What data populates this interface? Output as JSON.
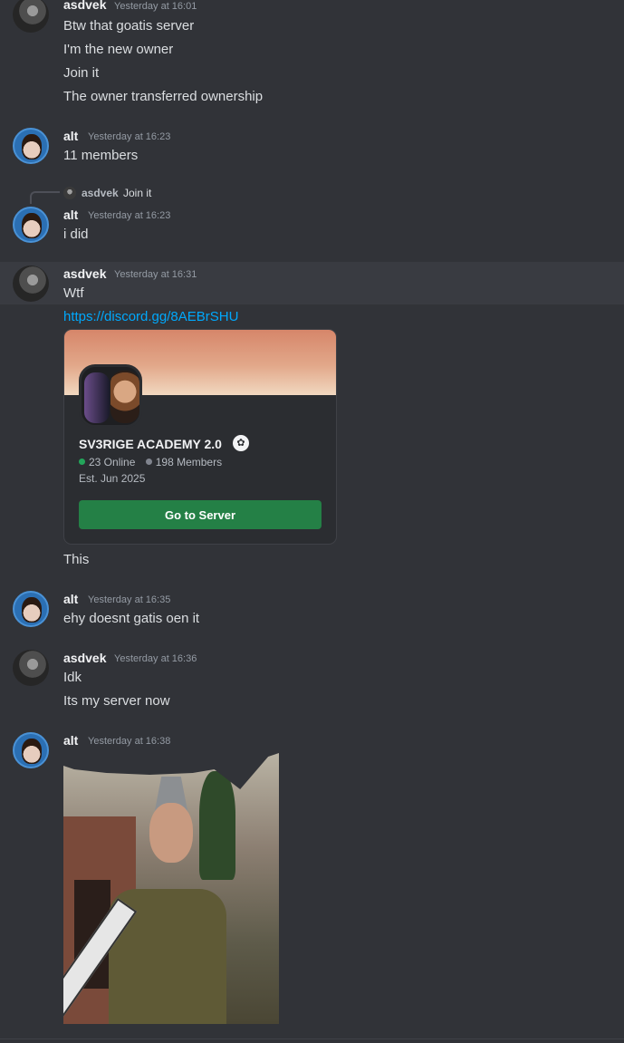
{
  "messages": [
    {
      "author": "asdvek",
      "time": "Yesterday at 16:01",
      "lines": [
        "Btw that goatis server",
        "I'm the new owner",
        "Join it",
        "The owner transferred ownership"
      ]
    },
    {
      "author": "alt",
      "time": "Yesterday at 16:23",
      "lines": [
        "11 members"
      ]
    },
    {
      "reply": {
        "author": "asdvek",
        "text": "Join it"
      },
      "author": "alt",
      "time": "Yesterday at 16:23",
      "lines": [
        "i did"
      ]
    },
    {
      "author": "asdvek",
      "time": "Yesterday at 16:31",
      "lines": [
        "Wtf",
        "https://discord.gg/8AEBrSHU",
        "This"
      ]
    },
    {
      "author": "alt",
      "time": "Yesterday at 16:35",
      "lines": [
        "ehy doesnt gatis oen it"
      ]
    },
    {
      "author": "asdvek",
      "time": "Yesterday at 16:36",
      "lines": [
        "Idk",
        "Its my server now"
      ]
    },
    {
      "author": "alt",
      "time": "Yesterday at 16:38",
      "lines": []
    }
  ],
  "invite": {
    "server_name": "SV3RIGE ACADEMY 2.0",
    "online": "23 Online",
    "members": "198 Members",
    "established": "Est. Jun 2025",
    "button_label": "Go to Server",
    "icon": "verified-badge-icon"
  },
  "colors": {
    "background": "#313338",
    "link": "#00a8fc",
    "button": "#248046",
    "online_dot": "#23a55a"
  }
}
